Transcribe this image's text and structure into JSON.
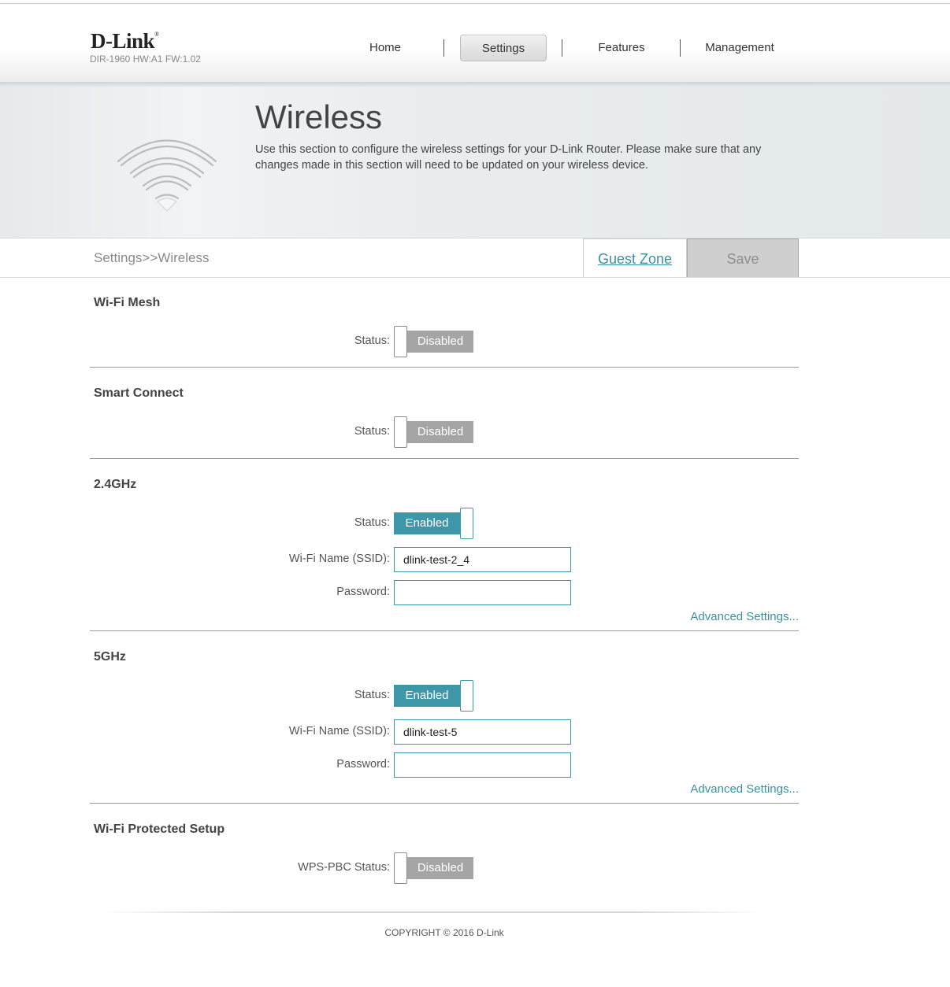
{
  "header": {
    "brand": "D-Link",
    "brand_mark": "®",
    "model": "DIR-1960 HW:A1 FW:1.02",
    "nav": [
      {
        "label": "Home"
      },
      {
        "label": "Settings",
        "active": true
      },
      {
        "label": "Features"
      },
      {
        "label": "Management"
      }
    ]
  },
  "banner": {
    "icon": "wifi-icon",
    "title": "Wireless",
    "description": "Use this section to configure the wireless settings for your D-Link Router. Please make sure that any changes made in this section will need to be updated on your wireless device."
  },
  "toolbar": {
    "breadcrumb": "Settings>>Wireless",
    "guest_zone_label": "Guest Zone",
    "save_label": "Save"
  },
  "sections": {
    "mesh": {
      "title": "Wi-Fi Mesh",
      "status_label": "Status:",
      "status": "Disabled"
    },
    "smart_connect": {
      "title": "Smart Connect",
      "status_label": "Status:",
      "status": "Disabled"
    },
    "band24": {
      "title": "2.4GHz",
      "status_label": "Status:",
      "status": "Enabled",
      "ssid_label": "Wi-Fi Name (SSID):",
      "ssid": "dlink-test-2_4",
      "password_label": "Password:",
      "password": "",
      "advanced_label": "Advanced Settings..."
    },
    "band5": {
      "title": "5GHz",
      "status_label": "Status:",
      "status": "Enabled",
      "ssid_label": "Wi-Fi Name (SSID):",
      "ssid": "dlink-test-5",
      "password_label": "Password:",
      "password": "",
      "advanced_label": "Advanced Settings..."
    },
    "wps": {
      "title": "Wi-Fi Protected Setup",
      "status_label": "WPS-PBC Status:",
      "status": "Disabled"
    }
  },
  "footer": {
    "copyright": "COPYRIGHT © 2016 D-Link"
  },
  "colors": {
    "accent": "#3d97a8",
    "disabled": "#a5a5a5",
    "link": "#3c8fa3"
  }
}
